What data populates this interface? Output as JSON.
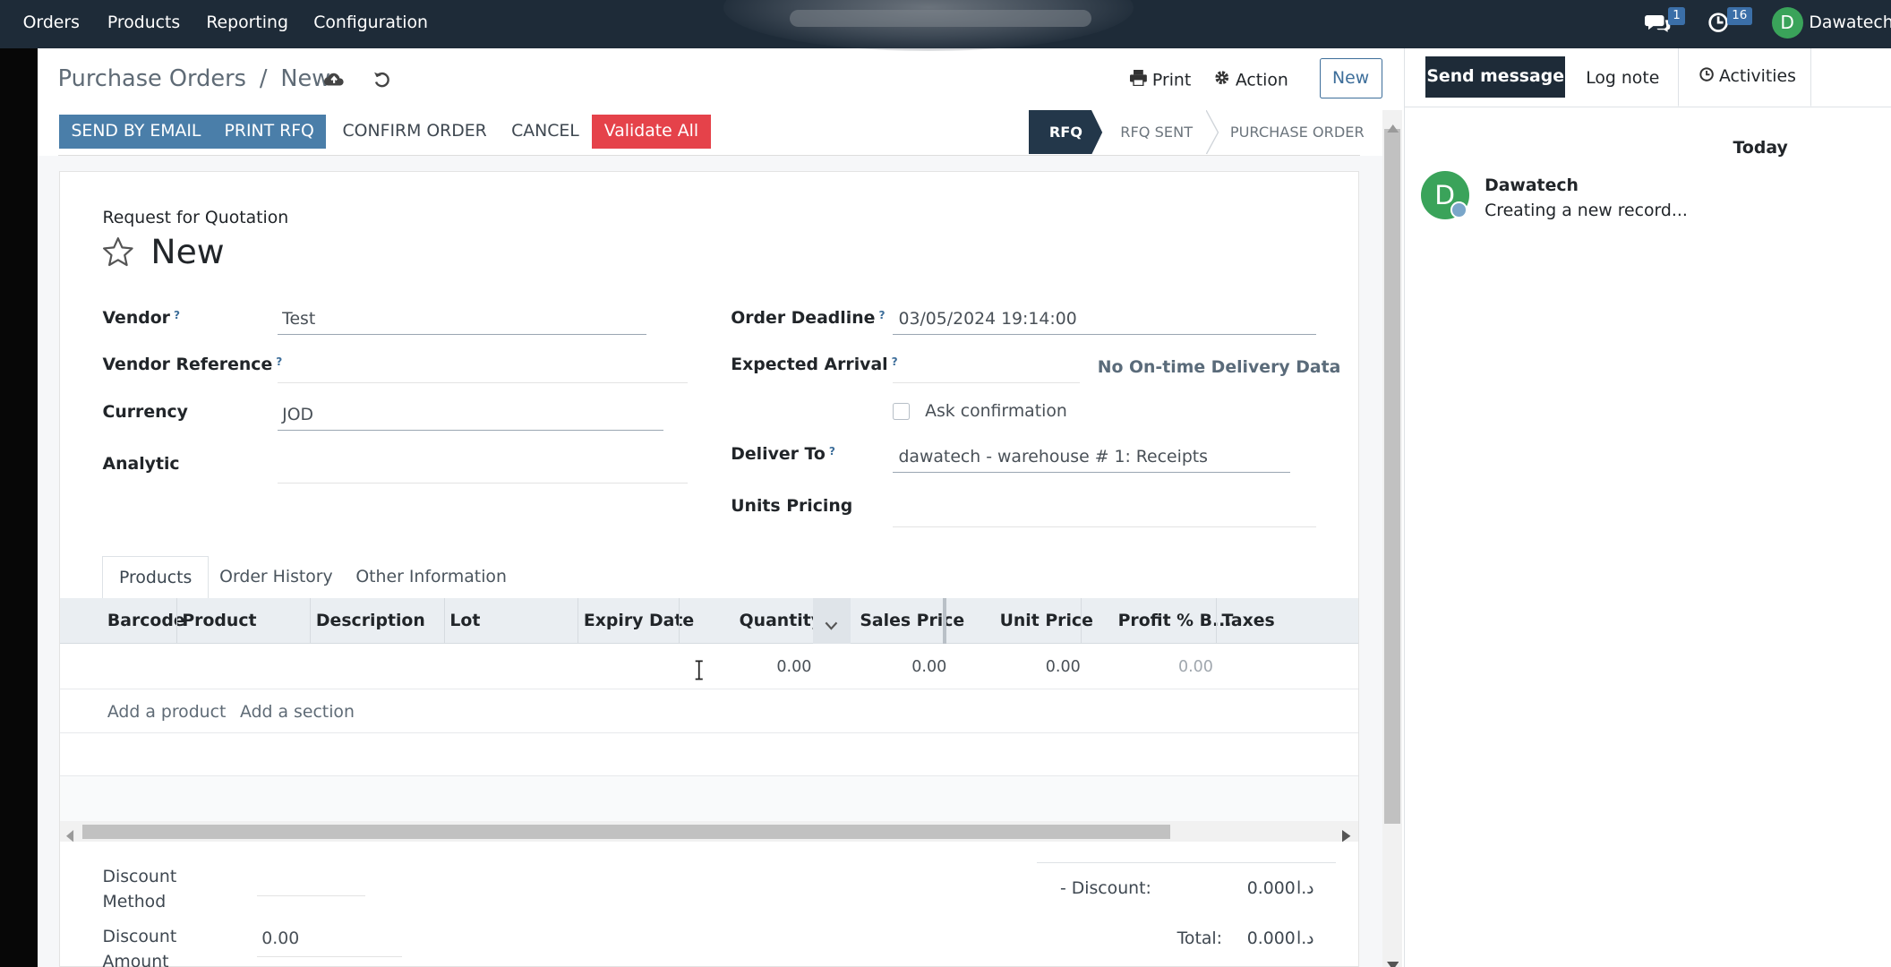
{
  "topbar": {
    "menu": [
      "Orders",
      "Products",
      "Reporting",
      "Configuration"
    ],
    "messages_count": "1",
    "activities_count": "16",
    "user_initial": "D",
    "user_name": "Dawatech"
  },
  "breadcrumb": {
    "parent": "Purchase Orders",
    "separator": "/",
    "current": "New"
  },
  "control": {
    "print": "Print",
    "action": "Action",
    "new": "New"
  },
  "statusbar": {
    "buttons": [
      "SEND BY EMAIL",
      "PRINT RFQ",
      "CONFIRM ORDER",
      "CANCEL",
      "Validate All"
    ],
    "stages": [
      "RFQ",
      "RFQ SENT",
      "PURCHASE ORDER"
    ],
    "active_stage": "RFQ"
  },
  "form": {
    "subtitle": "Request for Quotation",
    "title": "New",
    "help_mark": "?",
    "fields_left": {
      "vendor": {
        "label": "Vendor",
        "value": "Test"
      },
      "vendor_reference": {
        "label": "Vendor Reference",
        "value": ""
      },
      "currency": {
        "label": "Currency",
        "value": "JOD"
      },
      "analytic": {
        "label": "Analytic",
        "value": ""
      }
    },
    "fields_right": {
      "order_deadline": {
        "label": "Order Deadline",
        "value": "03/05/2024 19:14:00"
      },
      "expected_arrival": {
        "label": "Expected Arrival",
        "value": "",
        "info": "No On-time Delivery Data"
      },
      "ask_confirmation": {
        "label": "Ask confirmation",
        "checked": false
      },
      "deliver_to": {
        "label": "Deliver To",
        "value": "dawatech - warehouse # 1: Receipts"
      },
      "units_pricing": {
        "label": "Units Pricing",
        "value": ""
      }
    }
  },
  "tabs": [
    "Products",
    "Order History",
    "Other Information"
  ],
  "table": {
    "columns": [
      "Barcode",
      "Product",
      "Description",
      "Lot",
      "Expiry Date",
      "Quantity",
      "Sales Price",
      "Unit Price",
      "Profit % B...",
      "Taxes"
    ],
    "row": {
      "quantity": "0.00",
      "sales_price": "0.00",
      "unit_price": "0.00",
      "profit": "0.00"
    },
    "add_product": "Add a product",
    "add_section": "Add a section"
  },
  "footer": {
    "discount_method_label": "Discount Method",
    "discount_amount_label": "Discount Amount",
    "discount_amount_value": "0.00",
    "discount_label": "- Discount:",
    "discount_value": "0.000",
    "total_label": "Total:",
    "total_value": "0.000",
    "currency_symbol": "د.ا"
  },
  "chatter": {
    "send_message": "Send message",
    "log_note": "Log note",
    "activities": "Activities",
    "date_separator": "Today",
    "message_author": "Dawatech",
    "message_text": "Creating a new record..."
  },
  "colors": {
    "navbar": "#1e2b38",
    "primary": "#4a7ea9",
    "danger": "#e5424a",
    "stage_active": "#23374a",
    "avatar": "#3aa35a"
  }
}
